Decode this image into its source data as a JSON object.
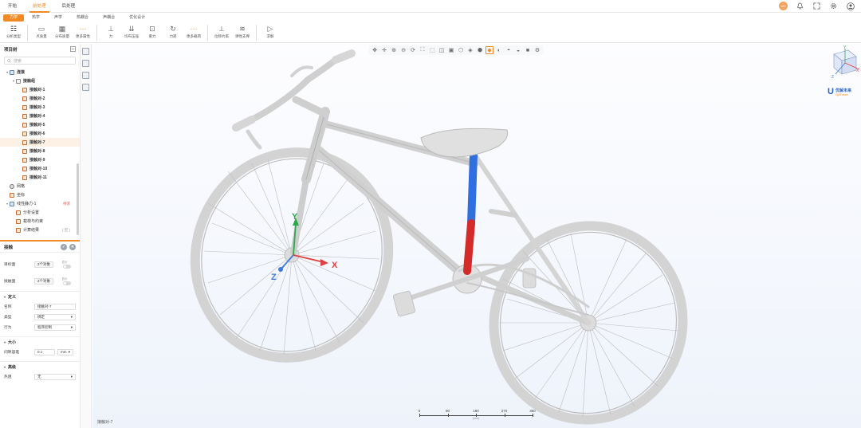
{
  "titlebar": {
    "tabs": [
      {
        "label": "开始",
        "active": false
      },
      {
        "label": "前处理",
        "active": true
      },
      {
        "label": "后处理",
        "active": false
      }
    ],
    "icons": [
      "user-badge-icon",
      "bell-icon",
      "fullscreen-icon",
      "gear-icon",
      "account-icon"
    ],
    "user_badge": "UG"
  },
  "subtabs": [
    {
      "label": "力学",
      "active": true
    },
    {
      "label": "热学",
      "active": false
    },
    {
      "label": "声学",
      "active": false
    },
    {
      "label": "热耦合",
      "active": false
    },
    {
      "label": "声耦合",
      "active": false
    },
    {
      "label": "优化设计",
      "active": false
    }
  ],
  "ribbon": {
    "groups": [
      [
        {
          "label": "分析类型",
          "icon": "analysis-type-icon",
          "selected": true
        }
      ],
      [
        {
          "label": "点质量",
          "icon": "point-mass-icon"
        },
        {
          "label": "分布质量",
          "icon": "distributed-mass-icon"
        },
        {
          "label": "更多属性",
          "icon": "more-properties-icon"
        }
      ],
      [
        {
          "label": "力",
          "icon": "force-icon"
        },
        {
          "label": "均布压强",
          "icon": "pressure-icon"
        },
        {
          "label": "重力",
          "icon": "gravity-icon"
        },
        {
          "label": "力矩",
          "icon": "moment-icon"
        },
        {
          "label": "更多载荷",
          "icon": "more-loads-icon"
        }
      ],
      [
        {
          "label": "位移约束",
          "icon": "displacement-constraint-icon"
        },
        {
          "label": "弹性支撑",
          "icon": "elastic-support-icon"
        }
      ],
      [
        {
          "label": "求解",
          "icon": "solve-icon"
        }
      ]
    ]
  },
  "project_tree": {
    "title": "项目树",
    "search_placeholder": "搜索",
    "nodes": [
      {
        "label": "连接",
        "level": 0,
        "arrow": "▾",
        "icon": "blue",
        "bold": true
      },
      {
        "label": "接触组",
        "level": 1,
        "arrow": "▾",
        "icon": "folder",
        "bold": true
      },
      {
        "label": "接触对-1",
        "level": 2,
        "icon": "orange",
        "bold": true
      },
      {
        "label": "接触对-2",
        "level": 2,
        "icon": "orange",
        "bold": true
      },
      {
        "label": "接触对-3",
        "level": 2,
        "icon": "orange",
        "bold": true
      },
      {
        "label": "接触对-4",
        "level": 2,
        "icon": "orange",
        "bold": true
      },
      {
        "label": "接触对-5",
        "level": 2,
        "icon": "orange",
        "bold": true
      },
      {
        "label": "接触对-6",
        "level": 2,
        "icon": "orange",
        "bold": true
      },
      {
        "label": "接触对-7",
        "level": 2,
        "icon": "orange",
        "bold": true,
        "selected": true
      },
      {
        "label": "接触对-8",
        "level": 2,
        "icon": "orange",
        "bold": true
      },
      {
        "label": "接触对-9",
        "level": 2,
        "icon": "orange",
        "bold": true
      },
      {
        "label": "接触对-10",
        "level": 2,
        "icon": "orange",
        "bold": true
      },
      {
        "label": "接触对-11",
        "level": 2,
        "icon": "orange",
        "bold": true
      },
      {
        "label": "网格",
        "level": 0,
        "icon": "grey"
      },
      {
        "label": "坐标",
        "level": 0,
        "icon": "orange"
      },
      {
        "label": "线性静力-1",
        "level": 0,
        "arrow": "▾",
        "icon": "blue",
        "badge": "待求",
        "badge_style": "red"
      },
      {
        "label": "分析设置",
        "level": 1,
        "icon": "orange"
      },
      {
        "label": "载荷与约束",
        "level": 1,
        "icon": "orange"
      },
      {
        "label": "计算结果",
        "level": 1,
        "icon": "orange",
        "badge": "( 空 )",
        "badge_style": "grey"
      }
    ]
  },
  "properties": {
    "title": "接触",
    "target_face_label": "目标面",
    "target_face_value": "2个对象",
    "contact_face_label": "接触面",
    "contact_face_value": "2个对象",
    "toggle_label": "显示",
    "section_define": "定义",
    "name_label": "名称",
    "name_value": "接触对-7",
    "type_label": "类型",
    "type_value": "绑定",
    "behavior_label": "行为",
    "behavior_value": "程序控制",
    "section_size": "大小",
    "gap_label": "间隙容差",
    "gap_value": "0.1",
    "gap_unit": "mm",
    "section_advanced": "高级",
    "thermal_label": "热阻",
    "thermal_value": "无"
  },
  "viewport": {
    "toolbar_icons": [
      "pan-move-icon",
      "crosshair-icon",
      "zoom-in-icon",
      "zoom-out-icon",
      "rotate-icon",
      "fit-icon",
      "box-select-icon",
      "wireframe-icon",
      "view-front-icon",
      "view-top-icon",
      "view-side-icon",
      "view-iso-icon",
      "shaded-icon",
      "render-mode-icon",
      "section-icon",
      "shadow-icon",
      "background-icon",
      "settings-icon"
    ],
    "active_toolbar_index": 12,
    "triad": {
      "x": "X",
      "y": "Y",
      "z": "Z"
    },
    "axis_labels": {
      "x": "X",
      "y": "Y",
      "z": "Z"
    },
    "logo_text": "优解未来",
    "logo_sub": "OptFuture",
    "status_text": "接触对-7",
    "scale": {
      "ticks": [
        "0",
        "90",
        "180",
        "270",
        "360"
      ],
      "unit": "(mm)"
    },
    "colors": {
      "highlight_top": "#2f6fe0",
      "highlight_bottom": "#d42a2a",
      "accent": "#f08a24"
    }
  }
}
